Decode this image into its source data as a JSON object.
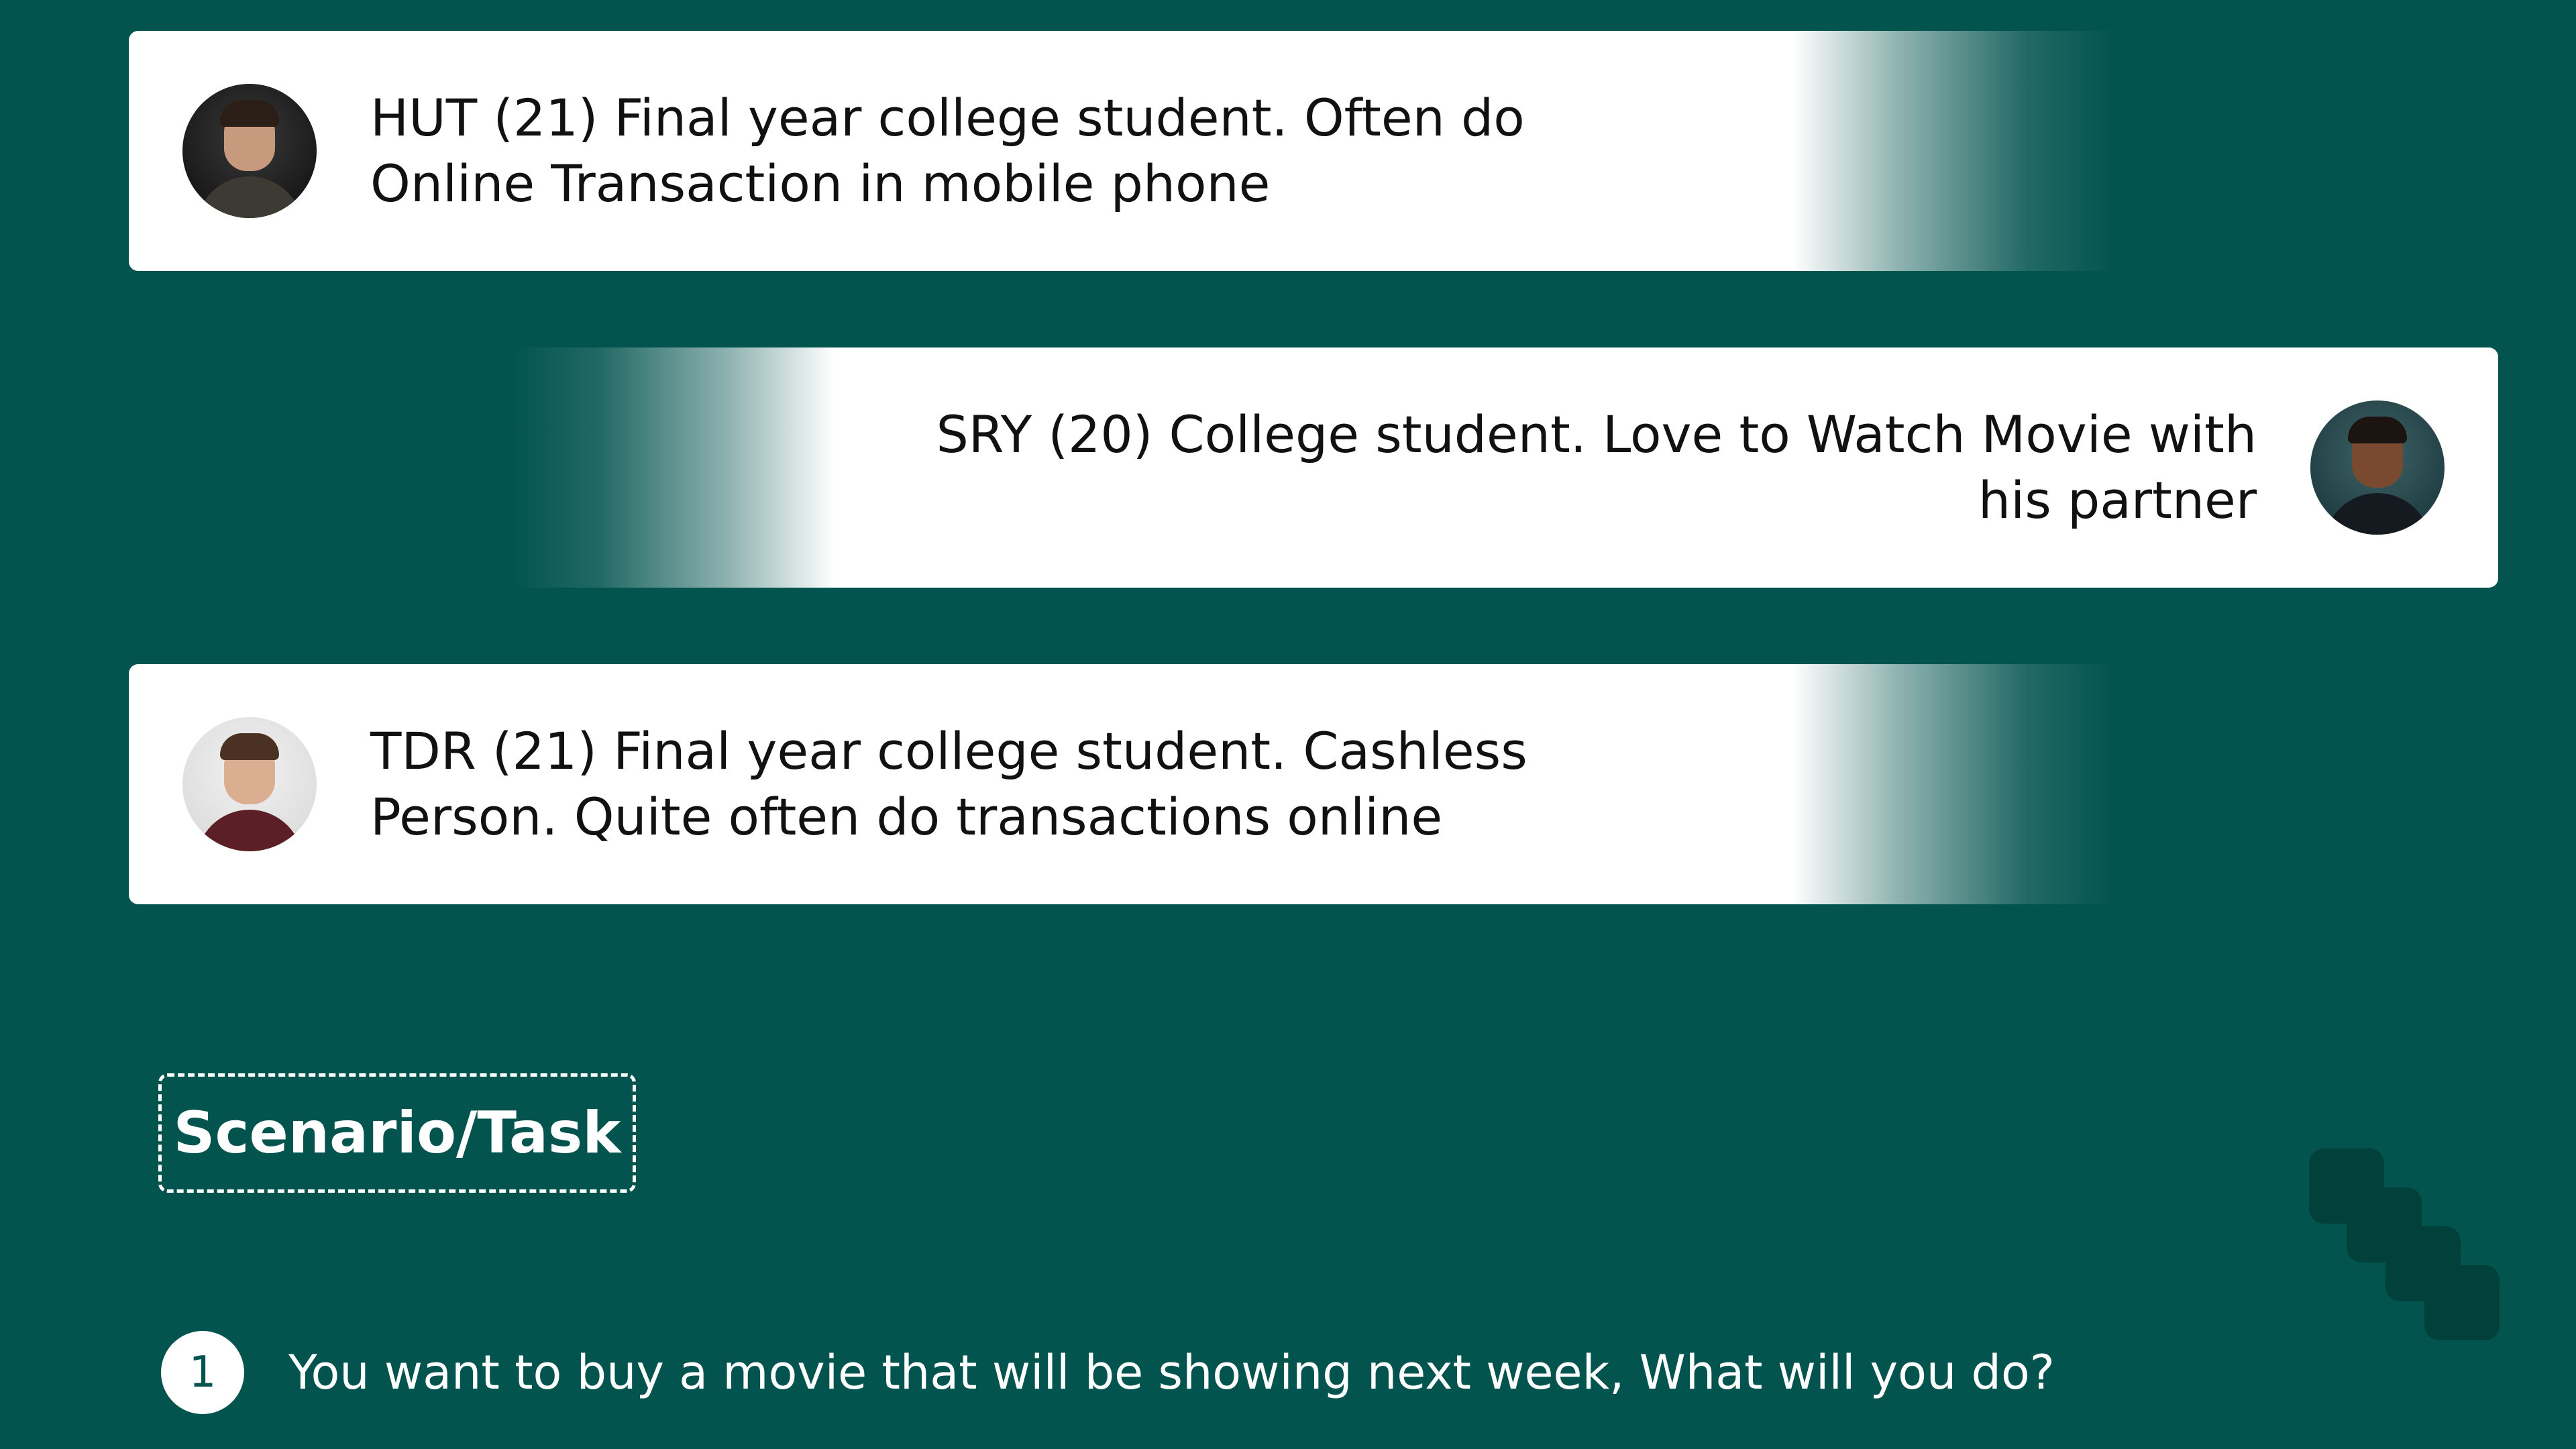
{
  "colors": {
    "background": "#03544f",
    "card": "#ffffff",
    "text_dark": "#111111",
    "text_light": "#ffffff",
    "decor": "#02403c"
  },
  "personas": [
    {
      "text": "HUT (21) Final year college student. Often do Online Transaction in mobile phone",
      "avatar": "person-photo"
    },
    {
      "text": "SRY (20) College student. Love to Watch Movie with his partner",
      "avatar": "person-photo"
    },
    {
      "text": "TDR (21) Final year college student. Cashless Person. Quite often do transactions online",
      "avatar": "person-photo"
    }
  ],
  "scenario": {
    "label": "Scenario/Task"
  },
  "questions": [
    {
      "number": "1",
      "text": "You want to buy a movie that will be showing next week, What will you do?"
    }
  ],
  "decor_icon": "stair-blocks-icon"
}
